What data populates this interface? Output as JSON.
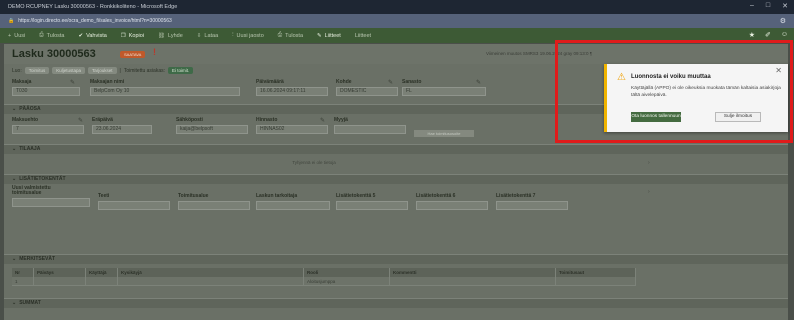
{
  "browser": {
    "window_title": "DEMO RCUPNEY Lasku 30000563 - Ronkkikoliteno - Microsoft Edge",
    "url": "https://login.directo.ee/ocra_demo_fi/sales_invoice/html?n=30000563",
    "window_controls": [
      "–",
      "□",
      "✕"
    ]
  },
  "toolbar": {
    "items": [
      {
        "label": "Uusi",
        "icon": "plus-icon"
      },
      {
        "label": "Tulosta",
        "icon": "print-icon"
      },
      {
        "label": "Vahvista",
        "icon": "check-icon"
      },
      {
        "label": "Kopioi",
        "icon": "copy-icon"
      },
      {
        "label": "Lyhde",
        "icon": "link-icon"
      },
      {
        "label": "Lataa",
        "icon": "download-icon"
      },
      {
        "label": "Uusi jaosto",
        "icon": "split-icon"
      },
      {
        "label": "Tulosta",
        "icon": "print-icon"
      },
      {
        "label": "Liitteet",
        "icon": "attach-icon"
      },
      {
        "label": "Liitteet",
        "icon": "link-icon"
      }
    ],
    "right_icons": [
      "star-icon",
      "pin-icon",
      "user-icon"
    ]
  },
  "document": {
    "title": "Lasku 30000563",
    "status_badge": "SAATAVA",
    "alert_mark": "!",
    "modified_text": "Viimeinen muutos SMRS3 19.06.2024 gray 09:13:0 ¶"
  },
  "tags": {
    "prefix": "Luo:",
    "items": [
      "Toimitus",
      "Kuljetustapa",
      "Tarjoukset"
    ],
    "separator": "|",
    "label": "Toimitettu asiakas:",
    "badge": "Ei toimit."
  },
  "top_fields": [
    {
      "label": "Maksaja",
      "value": "T030"
    },
    {
      "label": "Maksajan nimi",
      "value": "BelpCom Oy 10"
    },
    {
      "label": "Päivämäärä",
      "value": "16.06.2024 09:17:11"
    },
    {
      "label": "Kohde",
      "value": "DOMESTIC"
    },
    {
      "label": "Sanasto",
      "value": "FL"
    }
  ],
  "sections": {
    "paaosa": "PÄÄOSA",
    "tilaaja": "TILAAJA",
    "lisatietokentat": "LISÄTIETOKENTÄT",
    "merkitsit": "MERKITSEVÄT",
    "summat": "SUMMAT"
  },
  "paaosa_fields": [
    {
      "label": "Maksuehto",
      "value": "7"
    },
    {
      "label": "Eräpäivä",
      "value": "23.06.2024"
    },
    {
      "label": "Sähköposti",
      "value": "kaija@belpsoft"
    },
    {
      "label": "Hinnasto",
      "value": "HINNAS02"
    },
    {
      "label": "Myyjä",
      "value": ""
    }
  ],
  "paaosa_button": "Hae toimitusosoite",
  "tilaaja_empty": "Tyhjennä ei ole tietoja",
  "extra_fields": [
    {
      "label": "Uusi valmistettu toimitusalue",
      "value": ""
    },
    {
      "label": "Teeti",
      "value": ""
    },
    {
      "label": "Toimitusalue",
      "value": ""
    },
    {
      "label": "Laskun tarkoitaja",
      "value": ""
    },
    {
      "label": "Lisätietokenttä 5",
      "value": ""
    },
    {
      "label": "Lisätietokenttä 6",
      "value": ""
    },
    {
      "label": "Lisätietokenttä 7",
      "value": ""
    }
  ],
  "table": {
    "columns": [
      "Nr",
      "Päiväys",
      "Käyttäjä",
      "Kysikäyjä",
      "Rooli",
      "Kommentti",
      "Toimitusaut"
    ],
    "rows": [
      [
        "1",
        "",
        "",
        "",
        "Aloitusjumppa",
        "",
        ""
      ]
    ]
  },
  "dialog": {
    "title": "Luonnosta ei voiku muuttaa",
    "message": "Käyttäjällä (APPO) ei ole oikeuksia muokata tämän kaltaisia asiakirjoja tältä aivelepäivä.",
    "primary_button": "Ota luonnos tallennuun",
    "secondary_button": "Sulje ilmoitus",
    "close": "✕"
  },
  "colors": {
    "accent": "#446b40",
    "warning": "#f0b400",
    "highlight": "#e01b1b",
    "badge": "#c0592b"
  }
}
